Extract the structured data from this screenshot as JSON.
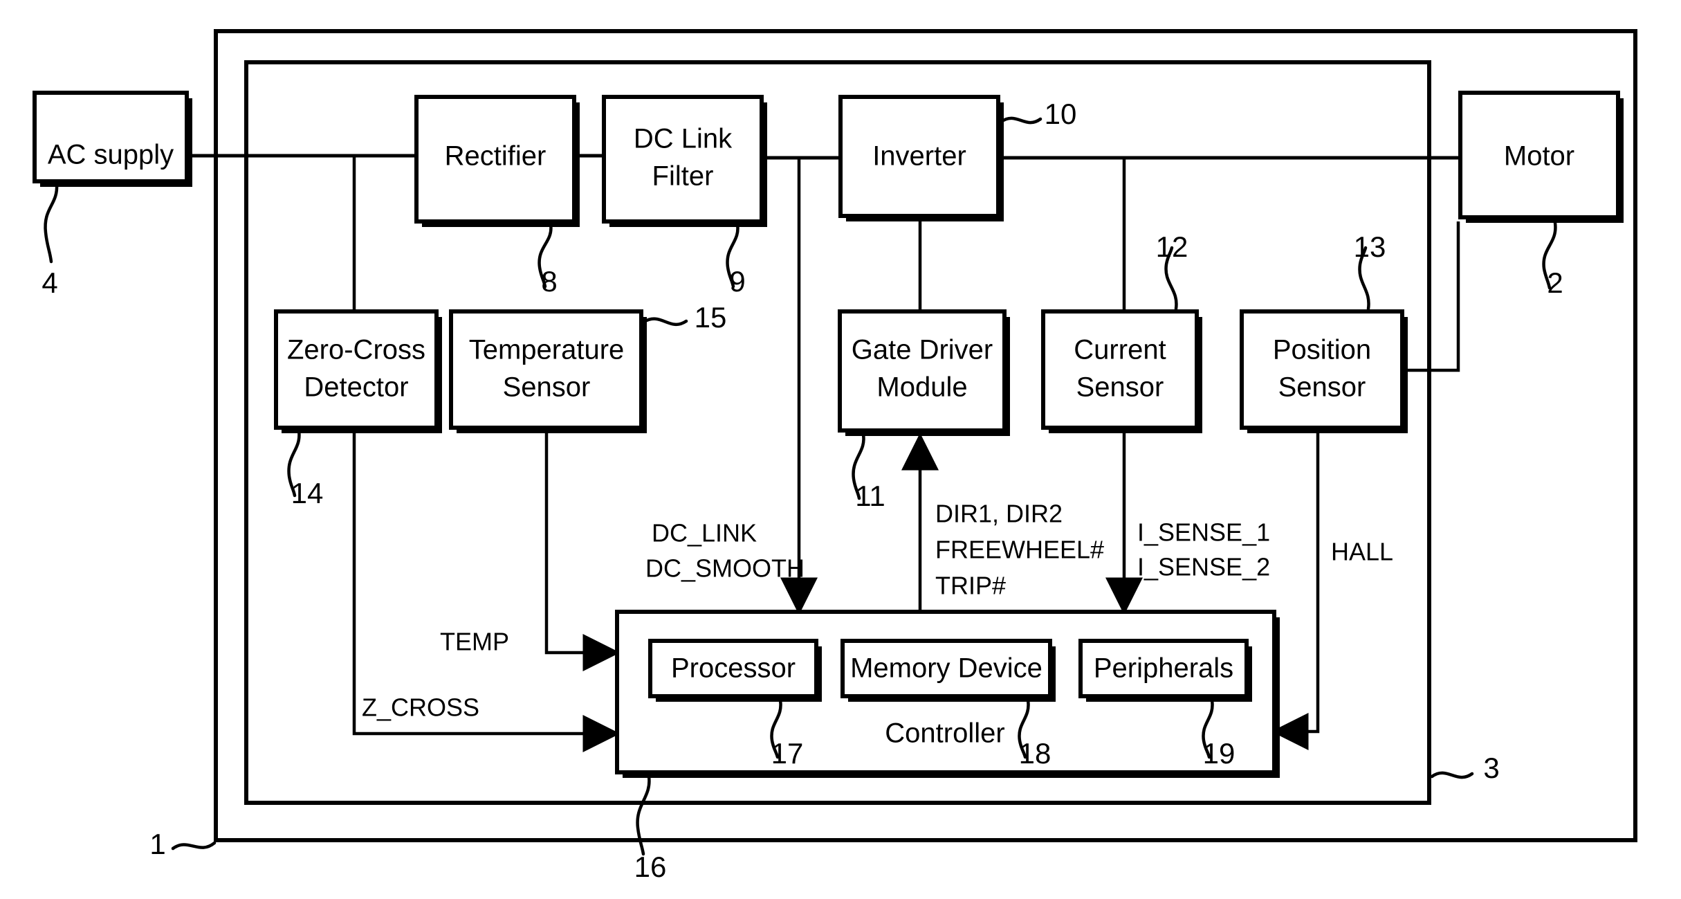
{
  "figure": {
    "type": "patent-block-diagram",
    "background": "#ffffff",
    "line_color": "#000000"
  },
  "blocks": {
    "ac_supply": "AC supply",
    "rectifier": "Rectifier",
    "dc_link_filter_line1": "DC Link",
    "dc_link_filter_line2": "Filter",
    "inverter": "Inverter",
    "motor": "Motor",
    "zero_cross_line1": "Zero-Cross",
    "zero_cross_line2": "Detector",
    "temperature_line1": "Temperature",
    "temperature_line2": "Sensor",
    "gate_driver_line1": "Gate Driver",
    "gate_driver_line2": "Module",
    "current_sensor_line1": "Current",
    "current_sensor_line2": "Sensor",
    "position_sensor_line1": "Position",
    "position_sensor_line2": "Sensor",
    "processor": "Processor",
    "memory_device": "Memory Device",
    "peripherals": "Peripherals",
    "controller": "Controller"
  },
  "signals": {
    "dc_link": "DC_LINK",
    "dc_smooth": "DC_SMOOTH",
    "dir": "DIR1, DIR2",
    "freewheel": "FREEWHEEL#",
    "trip": "TRIP#",
    "i_sense_1": "I_SENSE_1",
    "i_sense_2": "I_SENSE_2",
    "hall": "HALL",
    "temp": "TEMP",
    "z_cross": "Z_CROSS"
  },
  "reference_numerals": {
    "system": "1",
    "motor": "2",
    "control_system": "3",
    "ac_supply": "4",
    "rectifier": "8",
    "dc_link_filter": "9",
    "inverter": "10",
    "gate_driver_module": "11",
    "current_sensor": "12",
    "position_sensor": "13",
    "zero_cross_detector": "14",
    "temperature_sensor": "15",
    "controller": "16",
    "processor": "17",
    "memory_device": "18",
    "peripherals": "19"
  }
}
